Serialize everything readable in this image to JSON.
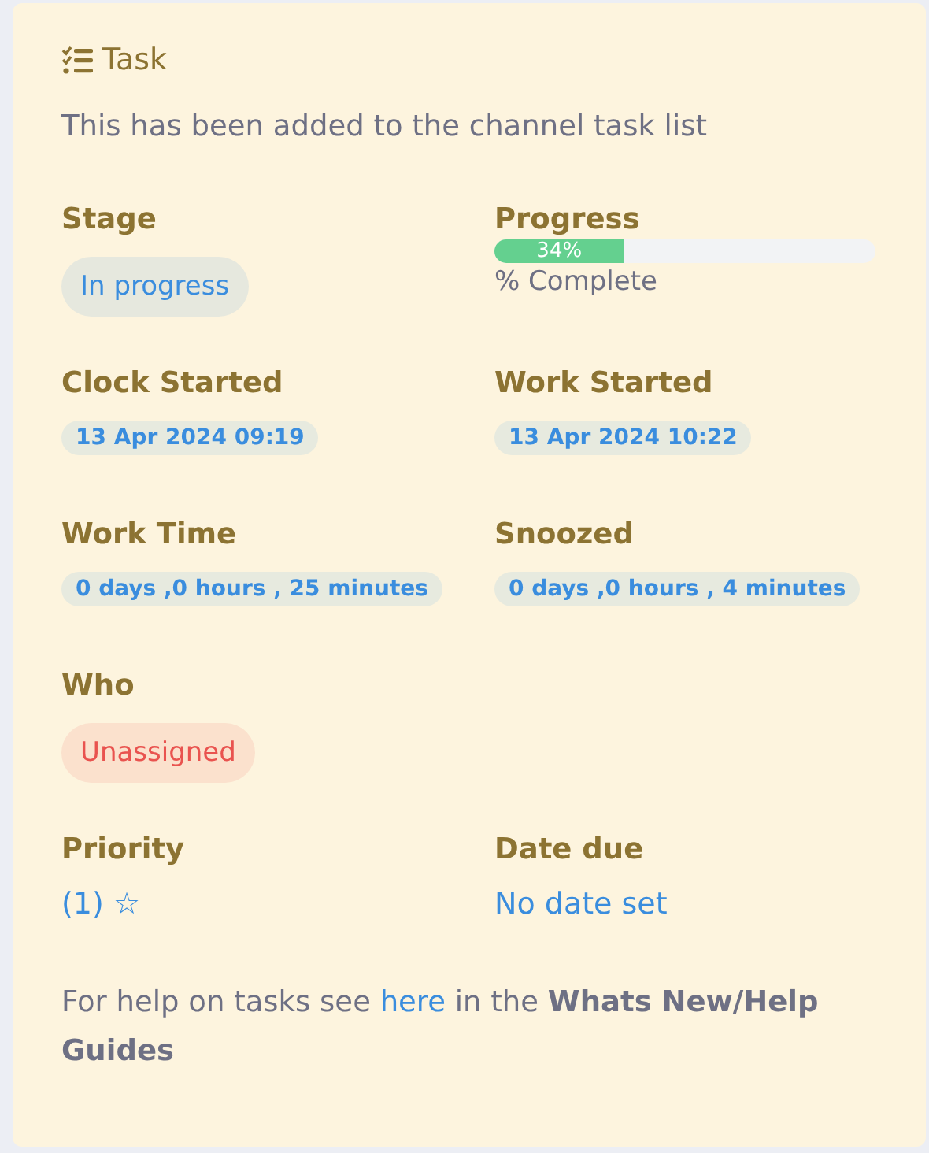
{
  "card": {
    "title": "Task",
    "subtitle": "This has been added to the channel task list",
    "rows": [
      {
        "fields": [
          {
            "label": "Stage",
            "kind": "pill",
            "color": "#3a8dde",
            "value": "In progress"
          },
          {
            "label": "Progress",
            "kind": "progress",
            "level": 0.34,
            "reading": "34%",
            "caption": "% Complete"
          }
        ]
      },
      {
        "fields": [
          {
            "label": "Clock Started",
            "kind": "chip",
            "value": "13 Apr 2024 09:19"
          },
          {
            "label": "Work Started",
            "kind": "chip",
            "value": "13 Apr 2024 10:22"
          }
        ]
      },
      {
        "fields": [
          {
            "label": "Work Time",
            "kind": "chip",
            "value": "0 days ,0 hours , 25 minutes"
          },
          {
            "label": "Snoozed",
            "kind": "chip",
            "value": "0 days ,0 hours , 4 minutes"
          }
        ]
      },
      {
        "fields": [
          {
            "label": "Who",
            "kind": "pill",
            "color": "#e9534f",
            "value": "Unassigned"
          }
        ]
      },
      {
        "fields": [
          {
            "label": "Priority",
            "kind": "link",
            "value": "(1) ☆"
          },
          {
            "label": "Date due",
            "kind": "link",
            "value": "No date set"
          }
        ]
      }
    ],
    "help": {
      "before": "For help on tasks see",
      "link": "here",
      "after": "in the **Whats New/Help Guides**"
    }
  }
}
